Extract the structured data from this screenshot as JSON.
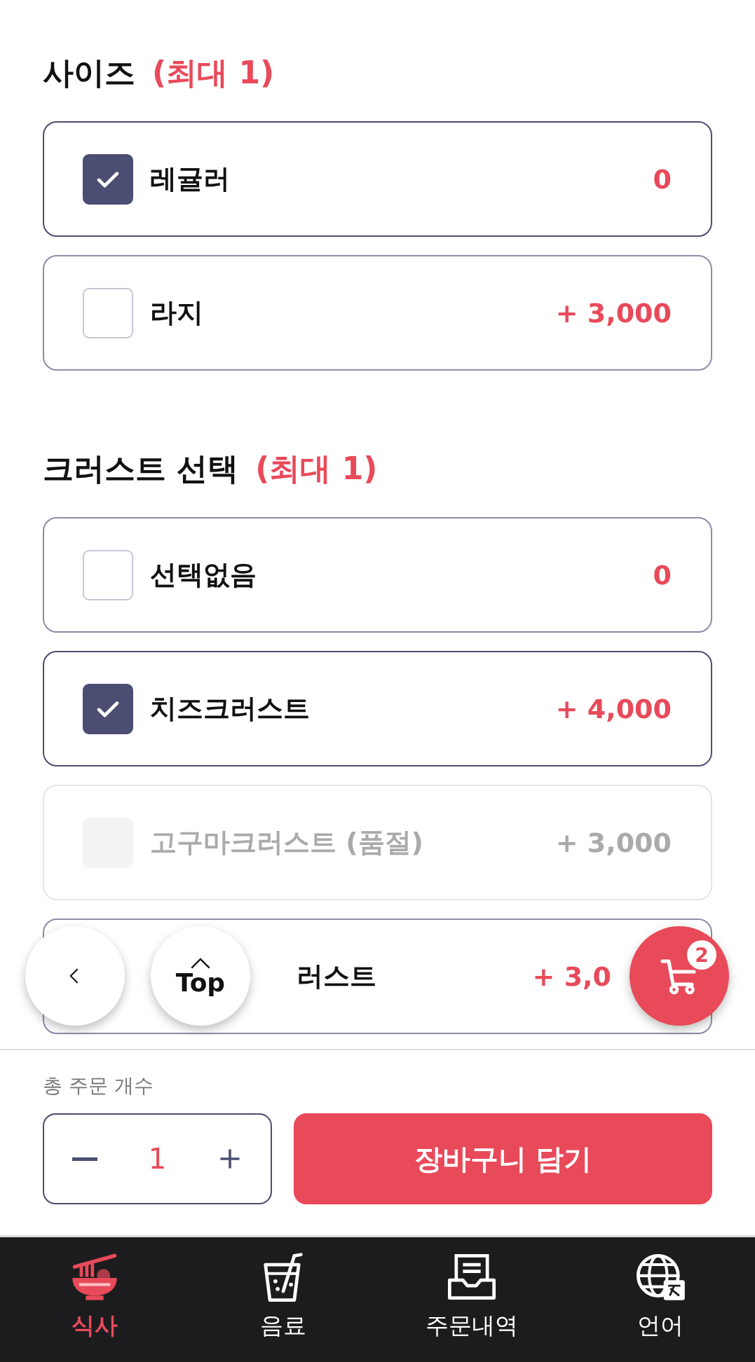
{
  "sections": [
    {
      "title": "사이즈",
      "limit": "(최대 1)",
      "options": [
        {
          "label": "레귤러",
          "price": "0",
          "checked": true,
          "disabled": false,
          "covered": false
        },
        {
          "label": "라지",
          "price": "+ 3,000",
          "checked": false,
          "disabled": false,
          "covered": false
        }
      ]
    },
    {
      "title": "크러스트 선택",
      "limit": "(최대 1)",
      "options": [
        {
          "label": "선택없음",
          "price": "0",
          "checked": false,
          "disabled": false,
          "covered": false
        },
        {
          "label": "치즈크러스트",
          "price": "+ 4,000",
          "checked": true,
          "disabled": false,
          "covered": false
        },
        {
          "label": "고구마크러스트 (품절)",
          "price": "+ 3,000",
          "checked": false,
          "disabled": true,
          "covered": false
        },
        {
          "label": "러스트",
          "price": "+ 3,0",
          "checked": false,
          "disabled": false,
          "covered": true
        }
      ]
    }
  ],
  "top_button": {
    "label": "Top"
  },
  "cart_button": {
    "badge": "2"
  },
  "order": {
    "label": "총 주문 개수",
    "quantity": "1",
    "button": "장바구니 담기"
  },
  "nav": [
    {
      "kind": "meal",
      "label": "식사",
      "selected": true
    },
    {
      "kind": "drink",
      "label": "음료",
      "selected": false
    },
    {
      "kind": "orders",
      "label": "주문내역",
      "selected": false
    },
    {
      "kind": "language",
      "label": "언어",
      "selected": false
    }
  ]
}
